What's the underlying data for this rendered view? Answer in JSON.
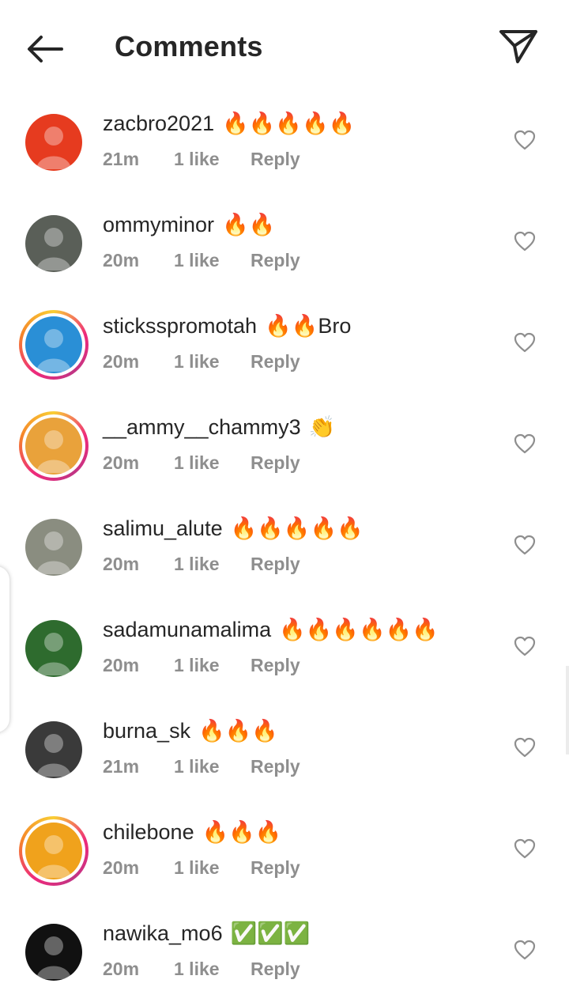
{
  "header": {
    "title": "Comments",
    "back_icon": "arrow-left-icon",
    "share_icon": "paper-plane-icon"
  },
  "comments": [
    {
      "username": "zacbro2021",
      "text": "🔥🔥🔥🔥🔥",
      "time": "21m",
      "likes": "1 like",
      "reply": "Reply",
      "story_ring": false,
      "avatar_color": "#e63b1f"
    },
    {
      "username": "ommyminor",
      "text": "🔥🔥",
      "time": "20m",
      "likes": "1 like",
      "reply": "Reply",
      "story_ring": false,
      "avatar_color": "#5a5f58"
    },
    {
      "username": "sticksspromotah",
      "text": "🔥🔥Bro",
      "time": "20m",
      "likes": "1 like",
      "reply": "Reply",
      "story_ring": true,
      "avatar_color": "#2a8fd6"
    },
    {
      "username": "__ammy__chammy3",
      "text": "👏",
      "time": "20m",
      "likes": "1 like",
      "reply": "Reply",
      "story_ring": true,
      "avatar_color": "#e9a23b"
    },
    {
      "username": "salimu_alute",
      "text": "🔥🔥🔥🔥🔥",
      "time": "20m",
      "likes": "1 like",
      "reply": "Reply",
      "story_ring": false,
      "avatar_color": "#8a8d80"
    },
    {
      "username": "sadamunamalima",
      "text": "🔥🔥🔥🔥🔥🔥",
      "time": "20m",
      "likes": "1 like",
      "reply": "Reply",
      "story_ring": false,
      "avatar_color": "#2e6b2e"
    },
    {
      "username": "burna_sk",
      "text": "🔥🔥🔥",
      "time": "21m",
      "likes": "1 like",
      "reply": "Reply",
      "story_ring": false,
      "avatar_color": "#3a3a3a"
    },
    {
      "username": "chilebone",
      "text": "🔥🔥🔥",
      "time": "20m",
      "likes": "1 like",
      "reply": "Reply",
      "story_ring": true,
      "avatar_color": "#f0a21c"
    },
    {
      "username": "nawika_mo6",
      "text": "✅✅✅",
      "time": "20m",
      "likes": "1 like",
      "reply": "Reply",
      "story_ring": false,
      "avatar_color": "#111111"
    }
  ],
  "icons": {
    "like": "heart-outline-icon"
  }
}
